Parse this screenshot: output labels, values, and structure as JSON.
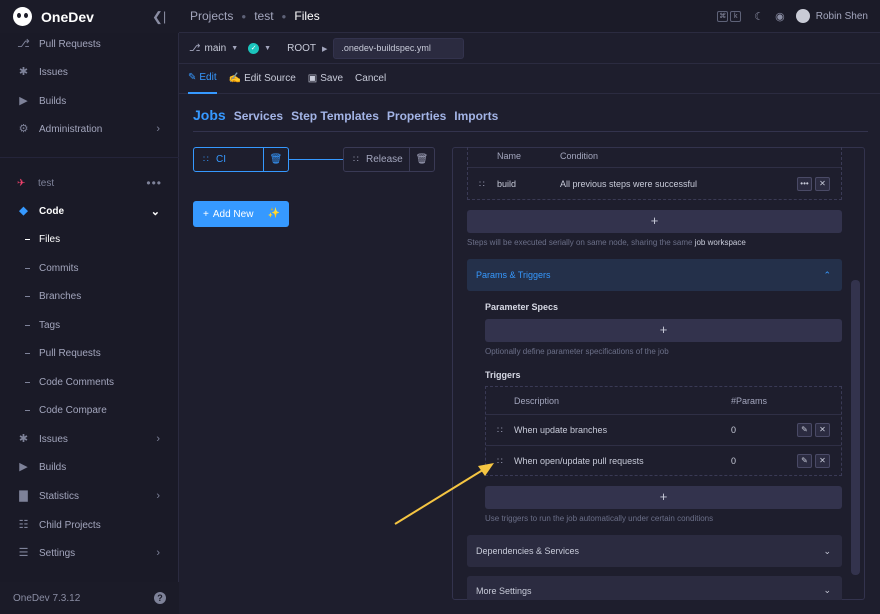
{
  "brand": {
    "name": "OneDev"
  },
  "sidebar": {
    "top_items": [
      {
        "label": "Pull Requests",
        "icon": "pull-request-icon"
      },
      {
        "label": "Issues",
        "icon": "bug-icon"
      },
      {
        "label": "Builds",
        "icon": "play-icon"
      },
      {
        "label": "Administration",
        "icon": "gear-icon"
      }
    ],
    "project": "test",
    "code_label": "Code",
    "code_sub": [
      "Files",
      "Commits",
      "Branches",
      "Tags",
      "Pull Requests",
      "Code Comments",
      "Code Compare"
    ],
    "bottom_items": [
      {
        "label": "Issues"
      },
      {
        "label": "Builds"
      },
      {
        "label": "Statistics"
      },
      {
        "label": "Child Projects"
      },
      {
        "label": "Settings"
      }
    ],
    "version": "OneDev 7.3.12"
  },
  "topbar": {
    "crumbs": [
      "Projects",
      "test",
      "Files"
    ],
    "keys": [
      "⌘",
      "k"
    ],
    "user": "Robin Shen"
  },
  "branchbar": {
    "branch": "main",
    "root": "ROOT",
    "file": ".onedev-buildspec.yml"
  },
  "editbar": {
    "edit": "Edit",
    "edit_source": "Edit Source",
    "save": "Save",
    "cancel": "Cancel"
  },
  "subtabs": [
    "Jobs",
    "Services",
    "Step Templates",
    "Properties",
    "Imports"
  ],
  "jobs": {
    "ci": "CI",
    "release": "Release",
    "add_new": "Add New"
  },
  "steps": {
    "col_name": "Name",
    "col_condition": "Condition",
    "row_name": "build",
    "row_condition": "All previous steps were successful",
    "hint_prefix": "Steps will be executed serially on same node, sharing the same ",
    "hint_link": "job workspace"
  },
  "params_triggers": {
    "header": "Params & Triggers",
    "param_specs_title": "Parameter Specs",
    "param_hint": "Optionally define parameter specifications of the job",
    "triggers_title": "Triggers",
    "col_description": "Description",
    "col_params": "#Params",
    "rows": [
      {
        "description": "When update branches",
        "params": "0"
      },
      {
        "description": "When open/update pull requests",
        "params": "0"
      }
    ],
    "trigger_hint": "Use triggers to run the job automatically under certain conditions"
  },
  "sections": {
    "dependencies": "Dependencies & Services",
    "more_settings": "More Settings"
  },
  "colors": {
    "accent": "#3699ff",
    "success": "#1bc5bd",
    "annotation_arrow": "#f5c542"
  }
}
